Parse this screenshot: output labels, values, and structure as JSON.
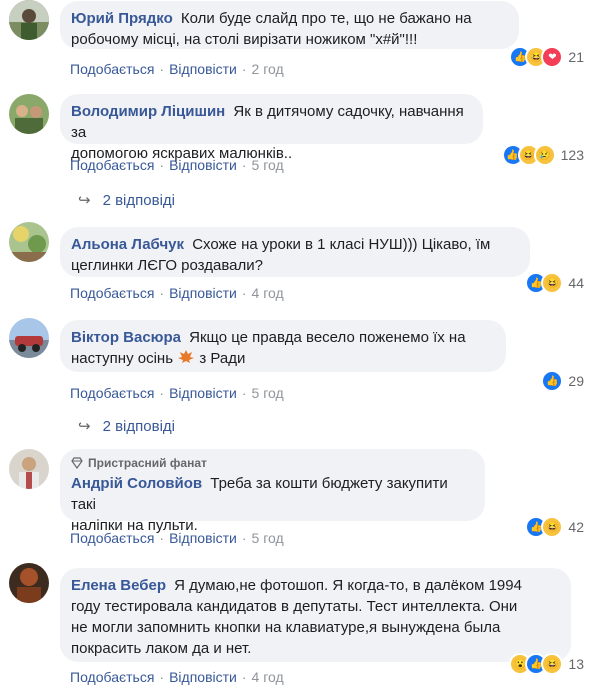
{
  "comments": [
    {
      "author": "Юрий Прядко",
      "text_lines": [
        "Коли буде слайд про те, що не бажано на",
        "робочому місці, на столі вирізати ножиком \"х#й\"!!!"
      ],
      "like_label": "Подобається",
      "reply_label": "Відповісти",
      "time": "2 год",
      "reactions": [
        "like",
        "haha",
        "love"
      ],
      "reaction_count": "21"
    },
    {
      "author": "Володимир Ліцишин",
      "text_lines": [
        "Як в дитячому садочку, навчання за",
        "допомогою яскравих малюнків.."
      ],
      "like_label": "Подобається",
      "reply_label": "Відповісти",
      "time": "5 год",
      "reactions": [
        "like",
        "haha",
        "sad"
      ],
      "reaction_count": "123",
      "replies_label": "2 відповіді"
    },
    {
      "author": "Альона Лабчук",
      "text_lines": [
        "Схоже на уроки в 1 класі НУШ))) Цікаво, їм",
        "цеглинки ЛЄГО роздавали?"
      ],
      "like_label": "Подобається",
      "reply_label": "Відповісти",
      "time": "4 год",
      "reactions": [
        "like",
        "haha"
      ],
      "reaction_count": "44"
    },
    {
      "author": "Віктор Васюра",
      "text_lines": [
        "Якщо це правда весело поженемо їх на",
        "наступну осінь",
        "з Ради"
      ],
      "like_label": "Подобається",
      "reply_label": "Відповісти",
      "time": "5 год",
      "reactions": [
        "like"
      ],
      "reaction_count": "29",
      "replies_label": "2 відповіді"
    },
    {
      "badge": "Пристрасний фанат",
      "author": "Андрій Соловйов",
      "text_lines": [
        "Треба за кошти бюджету закупити такі",
        "наліпки на пульти."
      ],
      "like_label": "Подобається",
      "reply_label": "Відповісти",
      "time": "5 год",
      "reactions": [
        "like",
        "haha"
      ],
      "reaction_count": "42"
    },
    {
      "author": "Елена Вебер",
      "text_lines": [
        "Я думаю,не фотошоп. Я когда-то, в далёком 1994",
        "году тестировала кандидатов в депутаты. Тест интеллекта. Они",
        "не могли запомнить кнопки на клавиатуре,я вынуждена была",
        "покрасить лаком да и нет."
      ],
      "like_label": "Подобається",
      "reply_label": "Відповісти",
      "time": "4 год",
      "reactions": [
        "wow",
        "like",
        "haha"
      ],
      "reaction_count": "13"
    }
  ],
  "colors": {
    "author": "#385898",
    "bubble_bg": "#f0f2f5",
    "like_reaction": "#1877f2",
    "love_reaction": "#f33e58",
    "emoji_yellow": "#f7c23d"
  }
}
